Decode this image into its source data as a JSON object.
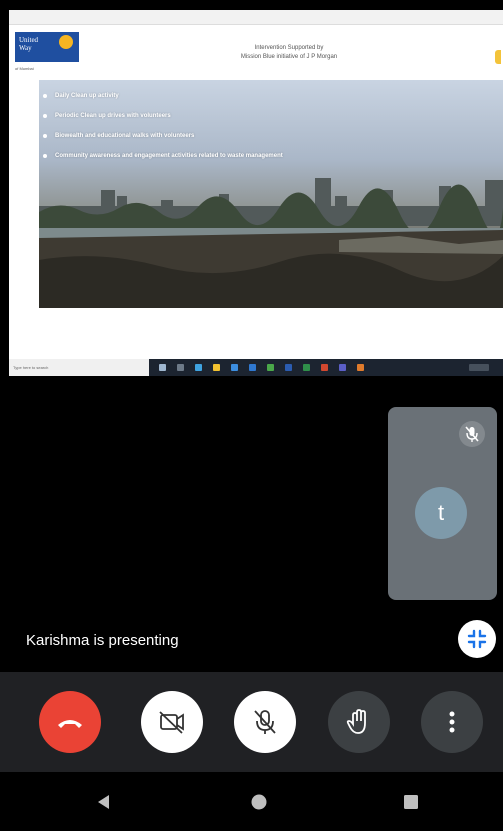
{
  "presentation": {
    "doc_titlebar": "",
    "logo": {
      "line1": "United",
      "line2": "Way",
      "subtitle": "of Mumbai"
    },
    "slide_title_line1": "Intervention Supported by",
    "slide_title_line2": "Mission Blue initiative of J P Morgan",
    "bullets": [
      "Daily Clean up activity",
      "Periodic Clean up drives with volunteers",
      "Biowealth and educational walks with volunteers",
      "Community awareness and engagement activities related to waste management"
    ],
    "footer_text": "",
    "taskbar_search_placeholder": "Type here to search"
  },
  "participant": {
    "initial": "t",
    "mic_muted": true
  },
  "presenting_label": "Karishma is presenting",
  "controls": {
    "end_call_color": "#ea4335",
    "buttons": [
      "end-call",
      "camera-off",
      "mic-off",
      "raise-hand",
      "more-options"
    ]
  },
  "android_nav": [
    "back",
    "home",
    "recents"
  ]
}
